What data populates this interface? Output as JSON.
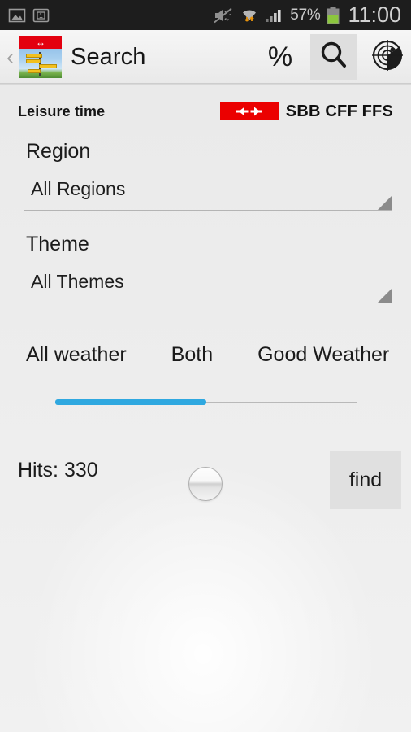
{
  "status_bar": {
    "icons": [
      "screenshot-icon",
      "sim-card-1-icon",
      "mute-icon",
      "wifi-icon",
      "signal-bars-icon"
    ],
    "battery_percent": "57%",
    "battery_level": 57,
    "clock": "11:00",
    "sim_badge": "1",
    "background": "#1d1d1d"
  },
  "action_bar": {
    "back_label": "‹",
    "app_icon": "sbb-signpost-icon",
    "title": "Search",
    "actions": [
      {
        "name": "percent-button",
        "glyph": "%",
        "selected": false
      },
      {
        "name": "search-button",
        "glyph": "search-icon",
        "selected": true
      },
      {
        "name": "radar-button",
        "glyph": "radar-icon",
        "selected": false
      }
    ]
  },
  "header": {
    "section_label": "Leisure time",
    "brand": {
      "mark": "sbb-cross-arrow-logo",
      "text": "SBB CFF FFS",
      "box_color": "#eb0000"
    }
  },
  "form": {
    "region": {
      "label": "Region",
      "value": "All Regions",
      "placeholder": "All Regions"
    },
    "theme": {
      "label": "Theme",
      "value": "All Themes",
      "placeholder": "All Themes"
    },
    "weather": {
      "options": [
        "All weather",
        "Both",
        "Good Weather"
      ],
      "slider_value": 50,
      "slider_min": 0,
      "slider_max": 100,
      "fill_color": "#2fa8e0"
    }
  },
  "results": {
    "hits_label": "Hits: 330",
    "hits_count": 330,
    "find_label": "find"
  }
}
